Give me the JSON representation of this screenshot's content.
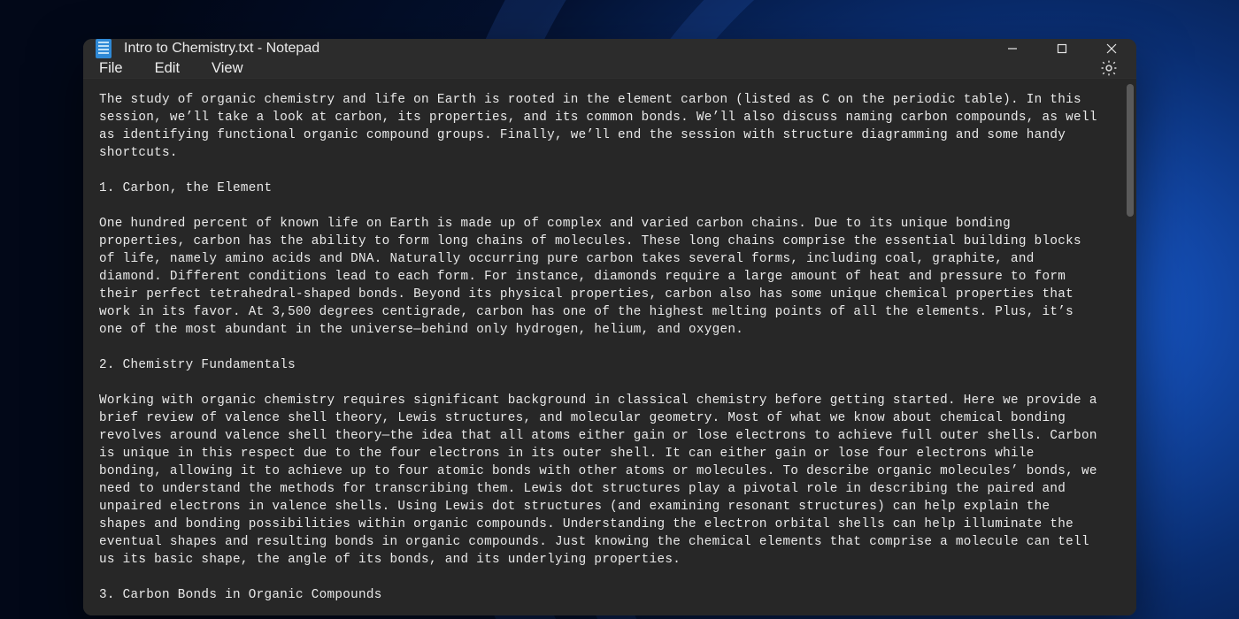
{
  "titlebar": {
    "title": "Intro to Chemistry.txt - Notepad"
  },
  "menu": {
    "file": "File",
    "edit": "Edit",
    "view": "View"
  },
  "document": {
    "text": "The study of organic chemistry and life on Earth is rooted in the element carbon (listed as C on the periodic table). In this session, we’ll take a look at carbon, its properties, and its common bonds. We’ll also discuss naming carbon compounds, as well as identifying functional organic compound groups. Finally, we’ll end the session with structure diagramming and some handy shortcuts.\n\n1. Carbon, the Element\n\nOne hundred percent of known life on Earth is made up of complex and varied carbon chains. Due to its unique bonding properties, carbon has the ability to form long chains of molecules. These long chains comprise the essential building blocks of life, namely amino acids and DNA. Naturally occurring pure carbon takes several forms, including coal, graphite, and diamond. Different conditions lead to each form. For instance, diamonds require a large amount of heat and pressure to form their perfect tetrahedral-shaped bonds. Beyond its physical properties, carbon also has some unique chemical properties that work in its favor. At 3,500 degrees centigrade, carbon has one of the highest melting points of all the elements. Plus, it’s one of the most abundant in the universe—behind only hydrogen, helium, and oxygen.\n\n2. Chemistry Fundamentals\n\nWorking with organic chemistry requires significant background in classical chemistry before getting started. Here we provide a brief review of valence shell theory, Lewis structures, and molecular geometry. Most of what we know about chemical bonding revolves around valence shell theory—the idea that all atoms either gain or lose electrons to achieve full outer shells. Carbon is unique in this respect due to the four electrons in its outer shell. It can either gain or lose four electrons while bonding, allowing it to achieve up to four atomic bonds with other atoms or molecules. To describe organic molecules’ bonds, we need to understand the methods for transcribing them. Lewis dot structures play a pivotal role in describing the paired and unpaired electrons in valence shells. Using Lewis dot structures (and examining resonant structures) can help explain the shapes and bonding possibilities within organic compounds. Understanding the electron orbital shells can help illuminate the eventual shapes and resulting bonds in organic compounds. Just knowing the chemical elements that comprise a molecule can tell us its basic shape, the angle of its bonds, and its underlying properties.\n\n3. Carbon Bonds in Organic Compounds"
  }
}
